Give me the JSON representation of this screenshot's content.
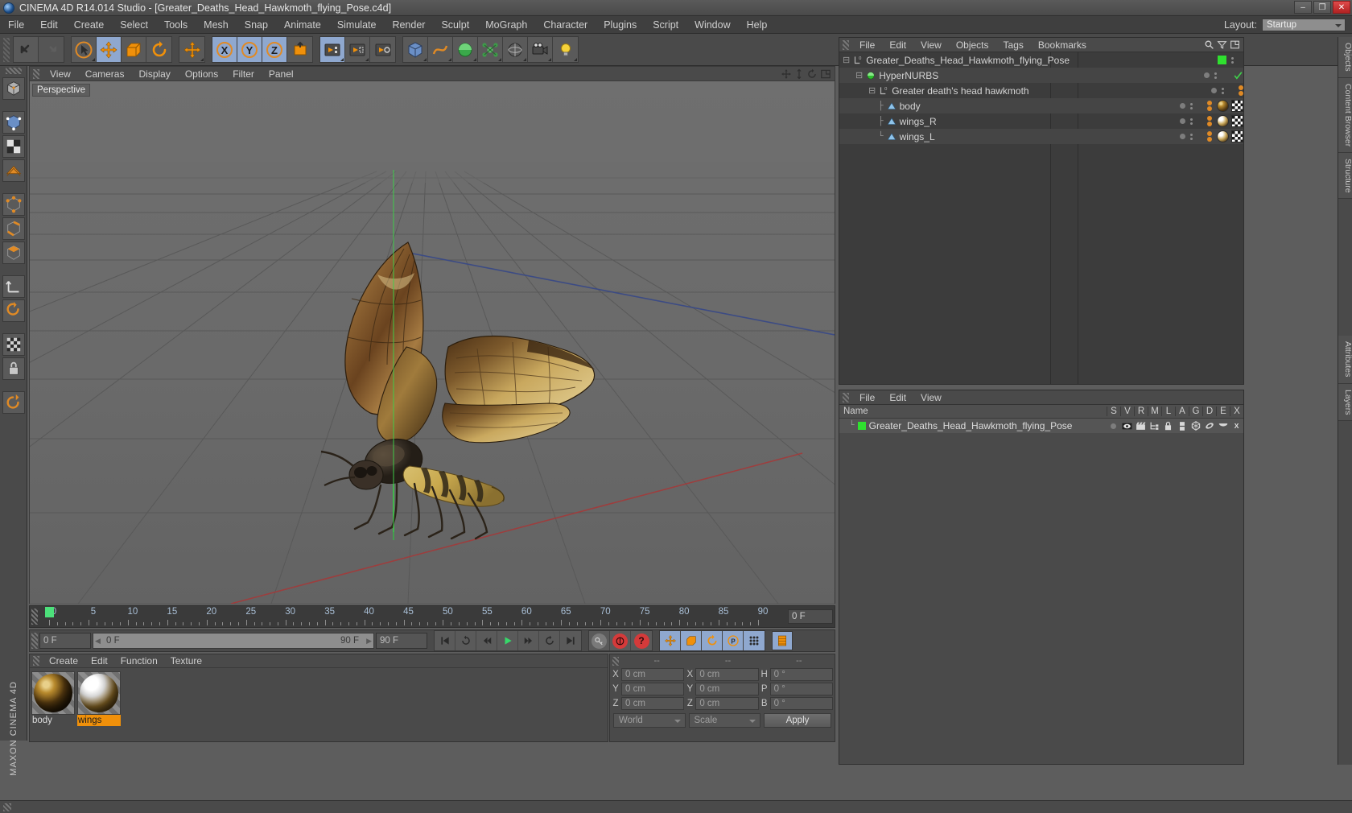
{
  "window": {
    "app_title": "CINEMA 4D R14.014 Studio - [Greater_Deaths_Head_Hawkmoth_flying_Pose.c4d]",
    "minimize": "–",
    "maximize": "❐",
    "close": "✕"
  },
  "menubar": {
    "items": [
      "File",
      "Edit",
      "Create",
      "Select",
      "Tools",
      "Mesh",
      "Snap",
      "Animate",
      "Simulate",
      "Render",
      "Sculpt",
      "MoGraph",
      "Character",
      "Plugins",
      "Script",
      "Window",
      "Help"
    ],
    "layout_label": "Layout:",
    "layout_value": "Startup"
  },
  "viewport": {
    "menus": [
      "View",
      "Cameras",
      "Display",
      "Options",
      "Filter",
      "Panel"
    ],
    "label": "Perspective",
    "axis_x": "X",
    "axis_y": "Y",
    "axis_z": "Z"
  },
  "timeline": {
    "ticks": [
      0,
      5,
      10,
      15,
      20,
      25,
      30,
      35,
      40,
      45,
      50,
      55,
      60,
      65,
      70,
      75,
      80,
      85,
      90
    ],
    "playhead_frame": 0,
    "frame_field": "0 F"
  },
  "transport": {
    "current_frame": "0 F",
    "range_start": "0 F",
    "range_end": "90 F",
    "end_frame": "90 F",
    "buttons": [
      "go-to-start",
      "previous-key",
      "previous-frame",
      "play",
      "next-frame",
      "next-key",
      "go-to-end"
    ]
  },
  "materials": {
    "menus": [
      "Create",
      "Edit",
      "Function",
      "Texture"
    ],
    "items": [
      {
        "name": "body",
        "selected": false
      },
      {
        "name": "wings",
        "selected": true
      }
    ]
  },
  "coordinates": {
    "headers": [
      "--",
      "--",
      "--"
    ],
    "rows": [
      {
        "pos_label": "X",
        "pos_value": "0 cm",
        "size_label": "X",
        "size_value": "0 cm",
        "rot_label": "H",
        "rot_value": "0 °"
      },
      {
        "pos_label": "Y",
        "pos_value": "0 cm",
        "size_label": "Y",
        "size_value": "0 cm",
        "rot_label": "P",
        "rot_value": "0 °"
      },
      {
        "pos_label": "Z",
        "pos_value": "0 cm",
        "size_label": "Z",
        "size_value": "0 cm",
        "rot_label": "B",
        "rot_value": "0 °"
      }
    ],
    "system": "World",
    "mode": "Scale",
    "apply": "Apply"
  },
  "object_manager": {
    "menus": [
      "File",
      "Edit",
      "View",
      "Objects",
      "Tags",
      "Bookmarks"
    ],
    "rows": [
      {
        "name": "Greater_Deaths_Head_Hawkmoth_flying_Pose",
        "depth": 0,
        "type": "null"
      },
      {
        "name": "HyperNURBS",
        "depth": 1,
        "type": "hypernurbs"
      },
      {
        "name": "Greater death's head hawkmoth",
        "depth": 2,
        "type": "null"
      },
      {
        "name": "body",
        "depth": 3,
        "type": "polygon"
      },
      {
        "name": "wings_R",
        "depth": 3,
        "type": "polygon"
      },
      {
        "name": "wings_L",
        "depth": 3,
        "type": "polygon"
      }
    ]
  },
  "layer_manager": {
    "menus": [
      "File",
      "Edit",
      "View"
    ],
    "columns": [
      "Name",
      "S",
      "V",
      "R",
      "M",
      "L",
      "A",
      "G",
      "D",
      "E",
      "X"
    ],
    "rows": [
      {
        "name": "Greater_Deaths_Head_Hawkmoth_flying_Pose",
        "color": "#2fe02f"
      }
    ]
  },
  "right_tabs": [
    "Objects",
    "Content Browser",
    "Structure",
    "Attributes",
    "Layers"
  ],
  "brand": "MAXON CINEMA 4D",
  "colors": {
    "accent_orange": "#f0900a",
    "active_blue": "#8fa8cf",
    "green": "#2fe02f",
    "panel_bg": "#4a4a4a",
    "viewport_bg": "#6a6a6a"
  }
}
